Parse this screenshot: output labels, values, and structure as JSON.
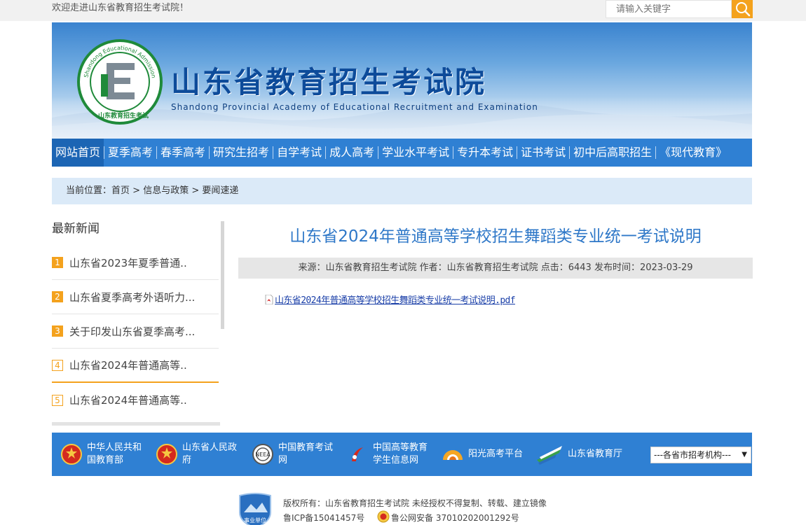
{
  "topbar": {
    "welcome": "欢迎走进山东省教育招生考试院！",
    "search_placeholder": "请输入关键字"
  },
  "banner": {
    "title": "山东省教育招生考试院",
    "subtitle": "Shandong Provincial Academy of Educational Recruitment and Examination",
    "logo_ring_text": "Shandong Educational Admission & Examinations",
    "logo_bottom_text": "山东教育招生考试"
  },
  "nav": {
    "items": [
      {
        "label": "网站首页",
        "active": true
      },
      {
        "label": "夏季高考"
      },
      {
        "label": "春季高考"
      },
      {
        "label": "研究生招考"
      },
      {
        "label": "自学考试"
      },
      {
        "label": "成人高考"
      },
      {
        "label": "学业水平考试"
      },
      {
        "label": "专升本考试"
      },
      {
        "label": "证书考试"
      },
      {
        "label": "初中后高职招生"
      },
      {
        "label": "《现代教育》"
      }
    ]
  },
  "breadcrumb": {
    "prefix": "当前位置：",
    "items": [
      "首页",
      "信息与政策",
      "要闻速递"
    ],
    "separator": " > "
  },
  "sidebar": {
    "title": "最新新闻",
    "items": [
      {
        "num": "1",
        "text": "山东省2023年夏季普通..",
        "style": "solid"
      },
      {
        "num": "2",
        "text": "山东省夏季高考外语听力...",
        "style": "solid"
      },
      {
        "num": "3",
        "text": "关于印发山东省夏季高考...",
        "style": "solid"
      },
      {
        "num": "4",
        "text": "山东省2024年普通高等..",
        "style": "outline"
      },
      {
        "num": "5",
        "text": "山东省2024年普通高等..",
        "style": "outline"
      }
    ]
  },
  "article": {
    "title": "山东省2024年普通高等学校招生舞蹈类专业统一考试说明",
    "meta": "来源：山东省教育招生考试院 作者：山东省教育招生考试院 点击：6443 发布时间：2023-03-29",
    "attachment": "山东省2024年普通高等学校招生舞蹈类专业统一考试说明.pdf"
  },
  "footer_links": {
    "items": [
      {
        "line1": "中华人民共和",
        "line2": "国教育部",
        "icon": "national-emblem-icon"
      },
      {
        "line1": "山东省人民政",
        "line2": "府",
        "icon": "national-emblem-icon"
      },
      {
        "line1": "中国教育考试",
        "line2": "网",
        "icon": "exam-center-icon"
      },
      {
        "line1": "中国高等教育",
        "line2": "学生信息网",
        "icon": "chsi-icon"
      },
      {
        "line1": "阳光高考平台",
        "line2": "",
        "icon": "sun-icon"
      },
      {
        "line1": "山东省教育厅",
        "line2": "",
        "icon": "edu-dept-icon"
      }
    ],
    "select_value": "---各省市招考机构---"
  },
  "copyright": {
    "line1": "版权所有：山东省教育招生考试院 未经授权不得复制、转载、建立镜像",
    "icp": "鲁ICP备15041457号",
    "police": "鲁公网安备 37010202001292号",
    "seal_text": "事业单位"
  },
  "colors": {
    "nav_blue": "#2f80d3",
    "nav_active": "#1c65b4",
    "accent_orange": "#f4a21d",
    "title_blue": "#2f78c8",
    "breadcrumb_bg": "#dbeaf8"
  }
}
